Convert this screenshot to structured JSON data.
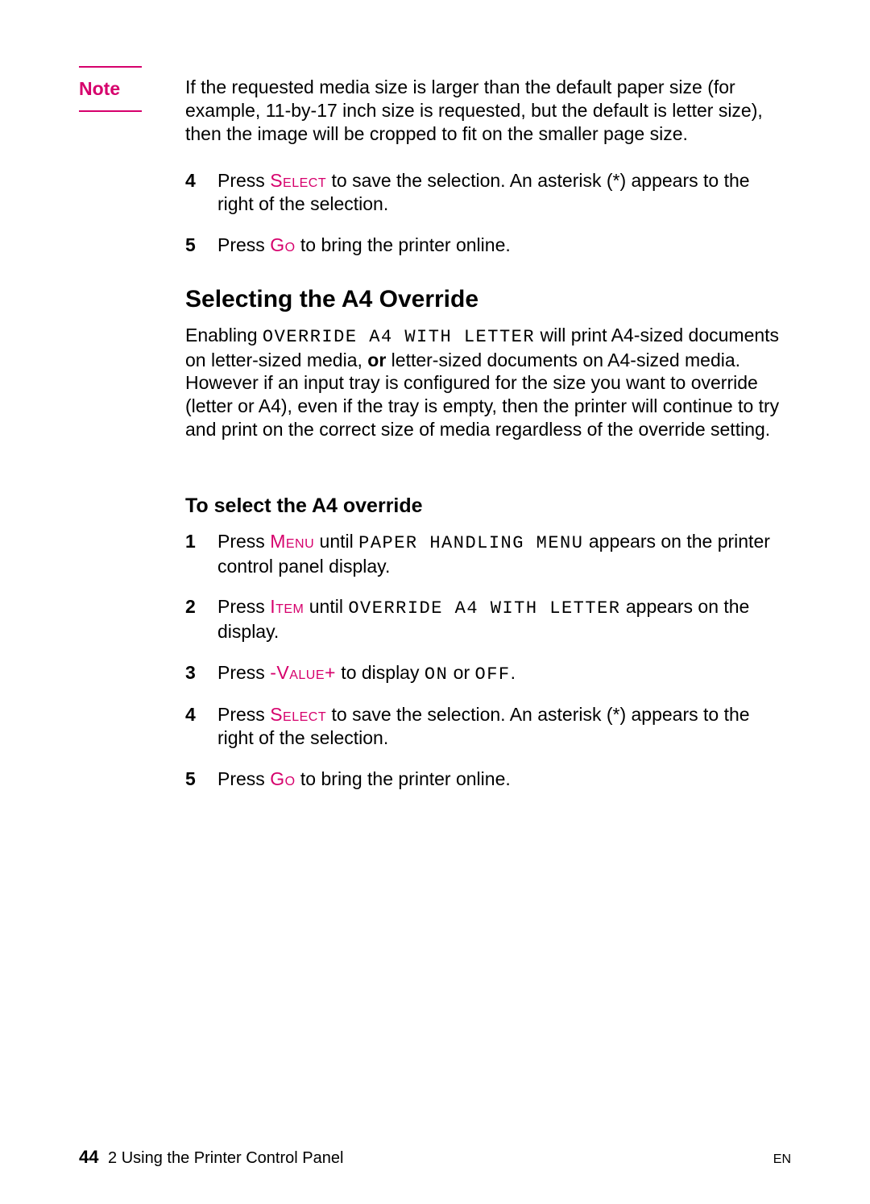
{
  "note": {
    "label": "Note",
    "body": "If the requested media size is larger than the default paper size (for example, 11-by-17 inch size is requested, but the default is letter size), then the image will be cropped to fit on the smaller page size."
  },
  "top_steps": [
    {
      "num": "4",
      "pre": "Press ",
      "kw": "Select",
      "post": " to save the selection. An asterisk (*) appears to the right of the selection."
    },
    {
      "num": "5",
      "pre": "Press ",
      "kw": "Go",
      "post": " to bring the printer online."
    }
  ],
  "section_heading": "Selecting the A4 Override",
  "section_para": {
    "t1": "Enabling ",
    "lcd1": "OVERRIDE A4 WITH LETTER",
    "t2": " will print A4-sized documents on letter-sized media, ",
    "bold": "or",
    "t3": " letter-sized documents on A4-sized media. However if an input tray is configured for the size you want to override (letter or A4), even if the tray is empty, then the printer will continue to try and print on the correct size of media regardless of the override setting."
  },
  "subsection_heading": "To select the A4 override",
  "steps": [
    {
      "num": "1",
      "t1": "Press ",
      "kw": "Menu",
      "t2": " until ",
      "lcd": "PAPER HANDLING MENU",
      "t3": " appears on the printer control panel display."
    },
    {
      "num": "2",
      "t1": "Press ",
      "kw": "Item",
      "t2": " until ",
      "lcd": "OVERRIDE A4 WITH LETTER",
      "t3": " appears on the display."
    },
    {
      "num": "3",
      "t1": "Press ",
      "kw": "-Value+",
      "t2": " to display ",
      "lcd": "ON",
      "t3": " or ",
      "lcd2": "OFF",
      "t4": "."
    },
    {
      "num": "4",
      "t1": "Press ",
      "kw": "Select",
      "t2": " to save the selection. An asterisk (*) appears to the right of the selection."
    },
    {
      "num": "5",
      "t1": "Press ",
      "kw": "Go",
      "t2": " to bring the printer online."
    }
  ],
  "footer": {
    "page": "44",
    "chapter": "2 Using the Printer Control Panel",
    "lang": "EN"
  }
}
